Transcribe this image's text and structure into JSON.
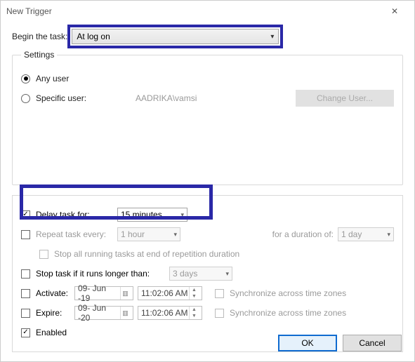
{
  "window": {
    "title": "New Trigger",
    "close_label": "Close"
  },
  "begin": {
    "label": "Begin the task:",
    "value": "At log on"
  },
  "settings": {
    "legend": "Settings",
    "any_user": "Any user",
    "specific_user": "Specific user:",
    "specific_user_value": "AADRIKA\\vamsi",
    "change_user": "Change User..."
  },
  "adv": {
    "delay": {
      "label": "Delay task for:",
      "value": "15 minutes",
      "checked": true
    },
    "repeat": {
      "label": "Repeat task every:",
      "value": "1 hour",
      "duration_label": "for a duration of:",
      "duration_value": "1 day",
      "checked": false
    },
    "stop_repetition": "Stop all running tasks at end of repetition duration",
    "stop_long": {
      "label": "Stop task if it runs longer than:",
      "value": "3 days",
      "checked": false
    },
    "activate": {
      "label": "Activate:",
      "date": "09- Jun -19",
      "time": "11:02:06 AM",
      "checked": false
    },
    "expire": {
      "label": "Expire:",
      "date": "09- Jun -20",
      "time": "11:02:06 AM",
      "checked": false
    },
    "sync": "Synchronize across time zones",
    "enabled": {
      "label": "Enabled",
      "checked": true
    }
  },
  "footer": {
    "ok": "OK",
    "cancel": "Cancel"
  }
}
